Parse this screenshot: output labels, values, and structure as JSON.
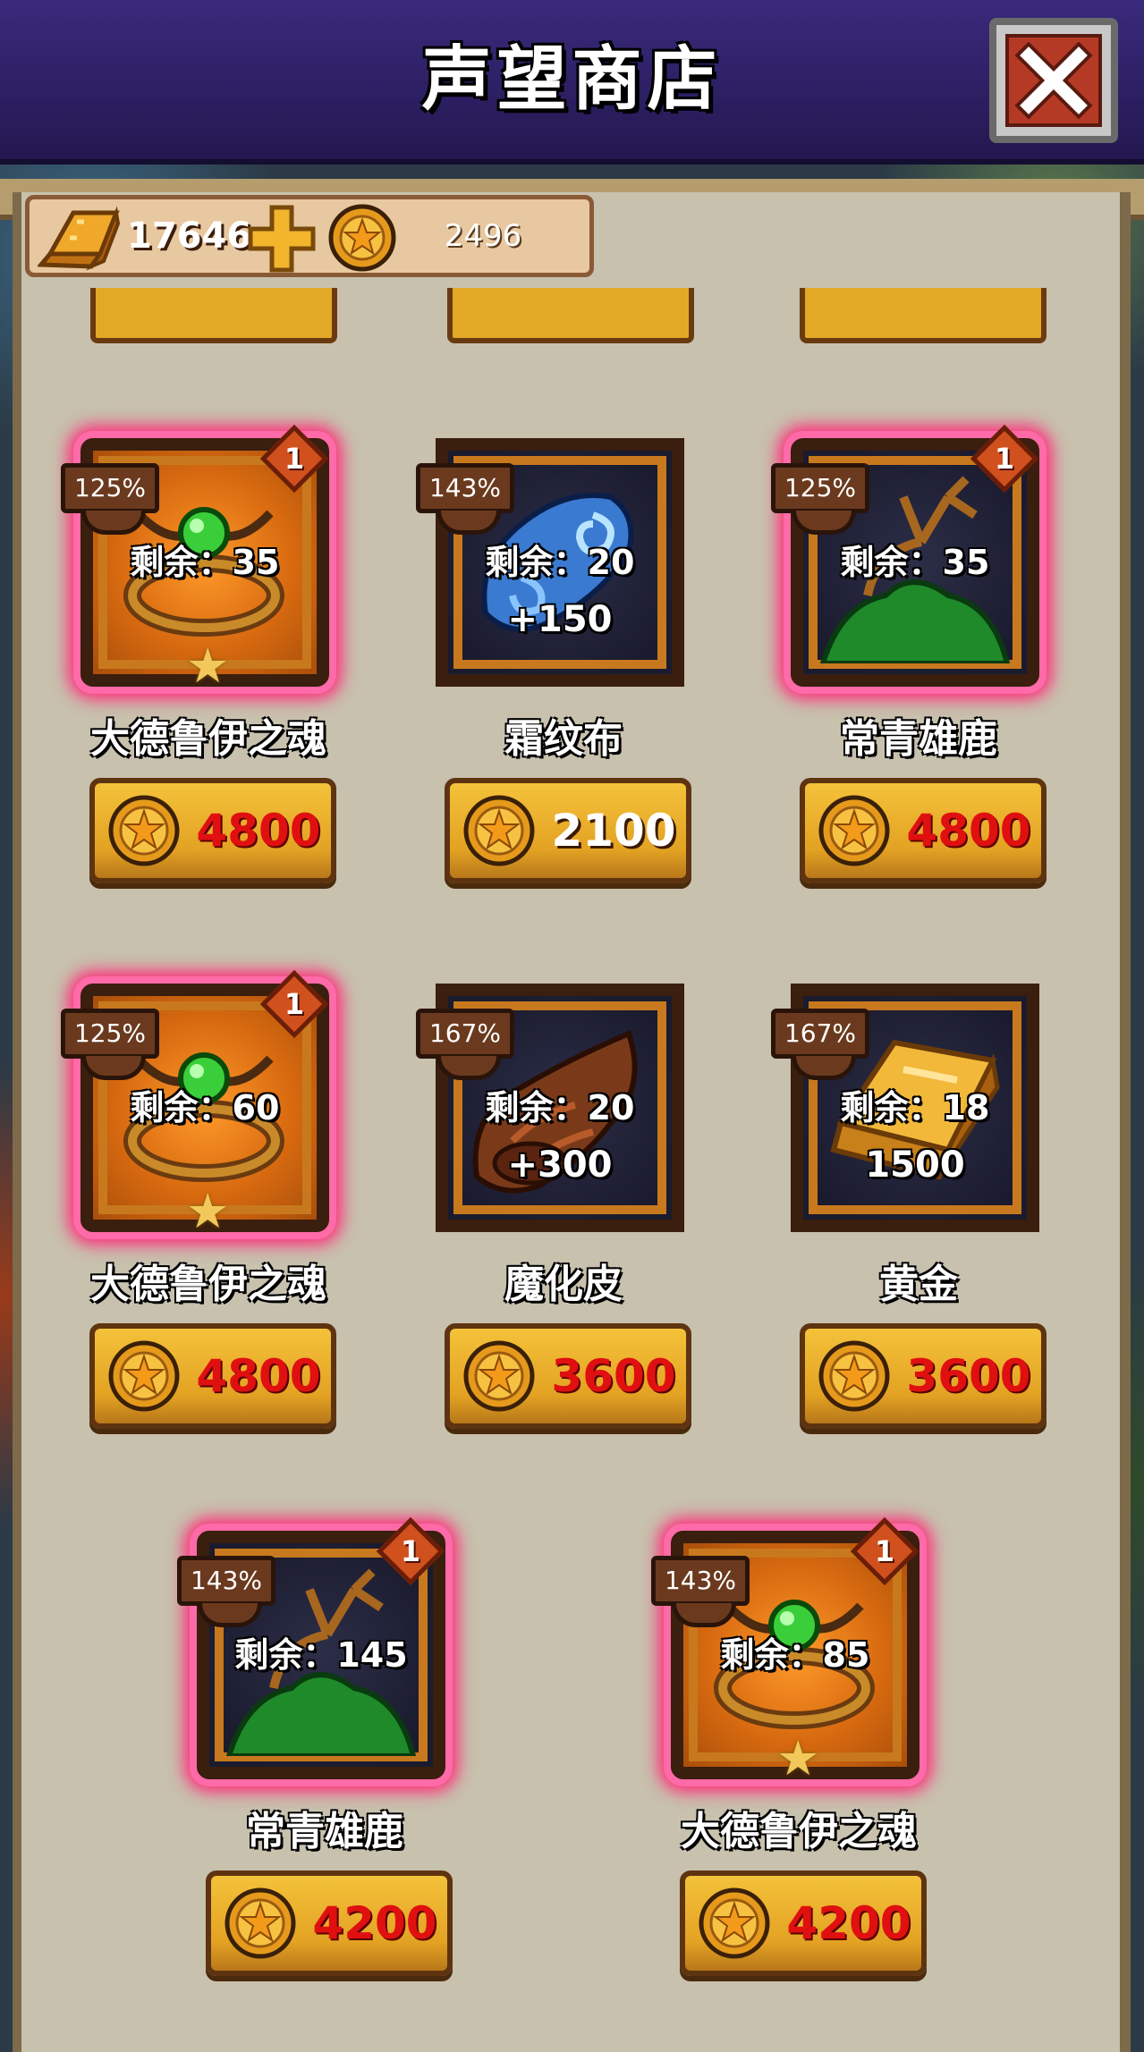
{
  "header": {
    "title": "声望商店"
  },
  "currency": {
    "gold": "17646",
    "coins": "2496"
  },
  "items": [
    {
      "name": "大德鲁伊之魂",
      "pct": "125%",
      "remaining": "剩余：35",
      "bonus": "",
      "price": "4800",
      "limit": "1",
      "highlight": true,
      "theme": "orange",
      "star": true,
      "art": "druid-soul"
    },
    {
      "name": "霜纹布",
      "pct": "143%",
      "remaining": "剩余：20",
      "bonus": "+150",
      "price": "2100",
      "limit": "",
      "highlight": false,
      "theme": "dark",
      "star": false,
      "art": "frost-cloth"
    },
    {
      "name": "常青雄鹿",
      "pct": "125%",
      "remaining": "剩余：35",
      "bonus": "",
      "price": "4800",
      "limit": "1",
      "highlight": true,
      "theme": "dark",
      "star": false,
      "art": "evergreen-stag"
    },
    {
      "name": "大德鲁伊之魂",
      "pct": "125%",
      "remaining": "剩余：60",
      "bonus": "",
      "price": "4800",
      "limit": "1",
      "highlight": true,
      "theme": "orange",
      "star": true,
      "art": "druid-soul"
    },
    {
      "name": "魔化皮",
      "pct": "167%",
      "remaining": "剩余：20",
      "bonus": "+300",
      "price": "3600",
      "limit": "",
      "highlight": false,
      "theme": "dark",
      "star": false,
      "art": "demonic-hide"
    },
    {
      "name": "黄金",
      "pct": "167%",
      "remaining": "剩余：18",
      "bonus": "1500",
      "price": "3600",
      "limit": "",
      "highlight": false,
      "theme": "dark",
      "star": false,
      "art": "gold-bar"
    },
    {
      "name": "常青雄鹿",
      "pct": "143%",
      "remaining": "剩余：145",
      "bonus": "",
      "price": "4200",
      "limit": "1",
      "highlight": true,
      "theme": "dark",
      "star": false,
      "art": "evergreen-stag"
    },
    {
      "name": "大德鲁伊之魂",
      "pct": "143%",
      "remaining": "剩余：85",
      "bonus": "",
      "price": "4200",
      "limit": "1",
      "highlight": true,
      "theme": "orange",
      "star": true,
      "art": "druid-soul"
    }
  ],
  "colors": {
    "price_red": "#e01010",
    "price_white": "#ffffff",
    "glow": "#ff2a78"
  }
}
